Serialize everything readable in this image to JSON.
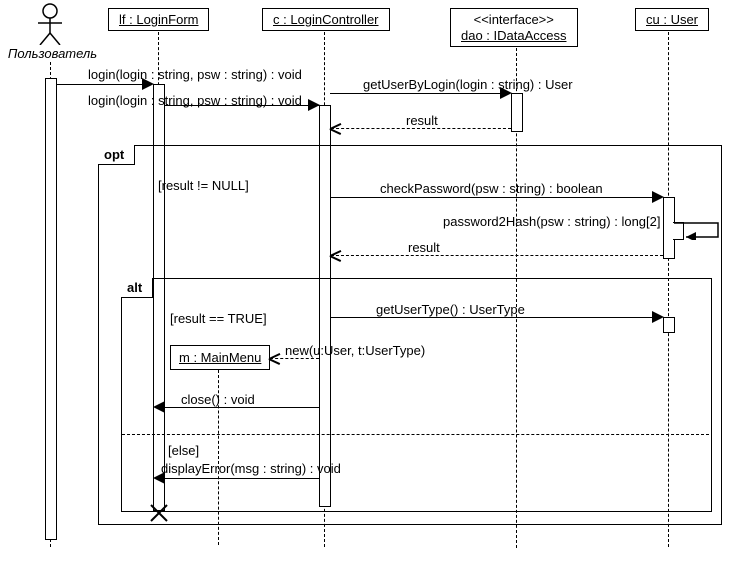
{
  "actor": {
    "label": "Пользователь"
  },
  "lifelines": {
    "lf": {
      "name": "lf : LoginForm"
    },
    "c": {
      "name": "c : LoginController"
    },
    "dao": {
      "stereotype": "<<interface>>",
      "name": "dao : IDataAccess"
    },
    "cu": {
      "name": "cu : User"
    }
  },
  "new_obj": {
    "name": "m : MainMenu"
  },
  "frames": {
    "opt": {
      "label": "opt",
      "guard": "[result != NULL]"
    },
    "alt": {
      "label": "alt",
      "guard1": "[result == TRUE]",
      "guard2": "[else]"
    }
  },
  "messages": {
    "m1": "login(login : string, psw : string) : void",
    "m2": "login(login : string, psw : string) : void",
    "m3": "getUserByLogin(login : string) : User",
    "m4": "result",
    "m5": "checkPassword(psw : string) : boolean",
    "m6": "password2Hash(psw : string) : long[2]",
    "m7": "result",
    "m8": "getUserType() : UserType",
    "m9": "new(u:User, t:UserType)",
    "m10": "close() : void",
    "m11": "displayError(msg : string) : void"
  },
  "chart_data": {
    "type": "uml-sequence-diagram",
    "actors": [
      "Пользователь"
    ],
    "lifelines": [
      "lf : LoginForm",
      "c : LoginController",
      "dao : IDataAccess <<interface>>",
      "cu : User"
    ],
    "messages": [
      {
        "from": "Пользователь",
        "to": "lf",
        "label": "login(login : string, psw : string) : void",
        "type": "sync"
      },
      {
        "from": "lf",
        "to": "c",
        "label": "login(login : string, psw : string) : void",
        "type": "sync"
      },
      {
        "from": "c",
        "to": "dao",
        "label": "getUserByLogin(login : string) : User",
        "type": "sync"
      },
      {
        "from": "dao",
        "to": "c",
        "label": "result",
        "type": "return"
      },
      {
        "frame": "opt",
        "guard": "[result != NULL]",
        "messages": [
          {
            "from": "c",
            "to": "cu",
            "label": "checkPassword(psw : string) : boolean",
            "type": "sync"
          },
          {
            "from": "cu",
            "to": "cu",
            "label": "password2Hash(psw : string) : long[2]",
            "type": "self"
          },
          {
            "from": "cu",
            "to": "c",
            "label": "result",
            "type": "return"
          },
          {
            "frame": "alt",
            "alternatives": [
              {
                "guard": "[result == TRUE]",
                "messages": [
                  {
                    "from": "c",
                    "to": "cu",
                    "label": "getUserType() : UserType",
                    "type": "sync"
                  },
                  {
                    "from": "c",
                    "to": "m : MainMenu",
                    "label": "new(u:User, t:UserType)",
                    "type": "create"
                  },
                  {
                    "from": "c",
                    "to": "lf",
                    "label": "close() : void",
                    "type": "sync"
                  },
                  {
                    "lifeline": "lf",
                    "event": "destroy"
                  }
                ]
              },
              {
                "guard": "[else]",
                "messages": [
                  {
                    "from": "c",
                    "to": "lf",
                    "label": "displayError(msg : string) : void",
                    "type": "sync"
                  }
                ]
              }
            ]
          }
        ]
      }
    ]
  }
}
